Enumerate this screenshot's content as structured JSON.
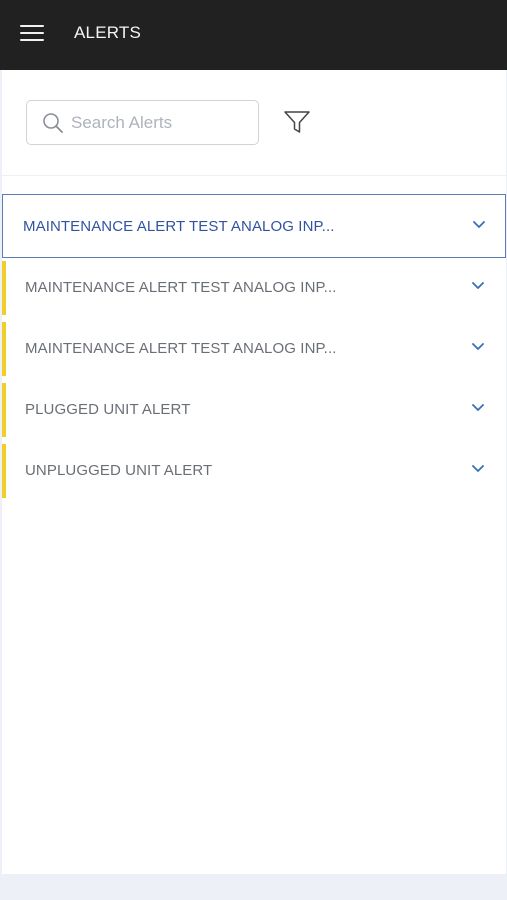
{
  "header": {
    "title": "ALERTS",
    "menu_icon": "hamburger-menu-icon"
  },
  "toolbar": {
    "search_placeholder": "Search Alerts",
    "search_value": "",
    "search_icon": "search-icon",
    "filter_icon": "filter-icon"
  },
  "alerts": [
    {
      "label": "MAINTENANCE ALERT TEST ANALOG INP...",
      "active": true
    },
    {
      "label": "MAINTENANCE ALERT TEST ANALOG INP...",
      "active": false
    },
    {
      "label": "MAINTENANCE ALERT TEST ANALOG INP...",
      "active": false
    },
    {
      "label": "PLUGGED UNIT ALERT",
      "active": false
    },
    {
      "label": "UNPLUGGED UNIT ALERT",
      "active": false
    }
  ],
  "colors": {
    "header_bg": "#212121",
    "active_border": "#5d7bb5",
    "active_text": "#3054a0",
    "stripe": "#f0cf2d",
    "chevron": "#3a6fb8"
  }
}
